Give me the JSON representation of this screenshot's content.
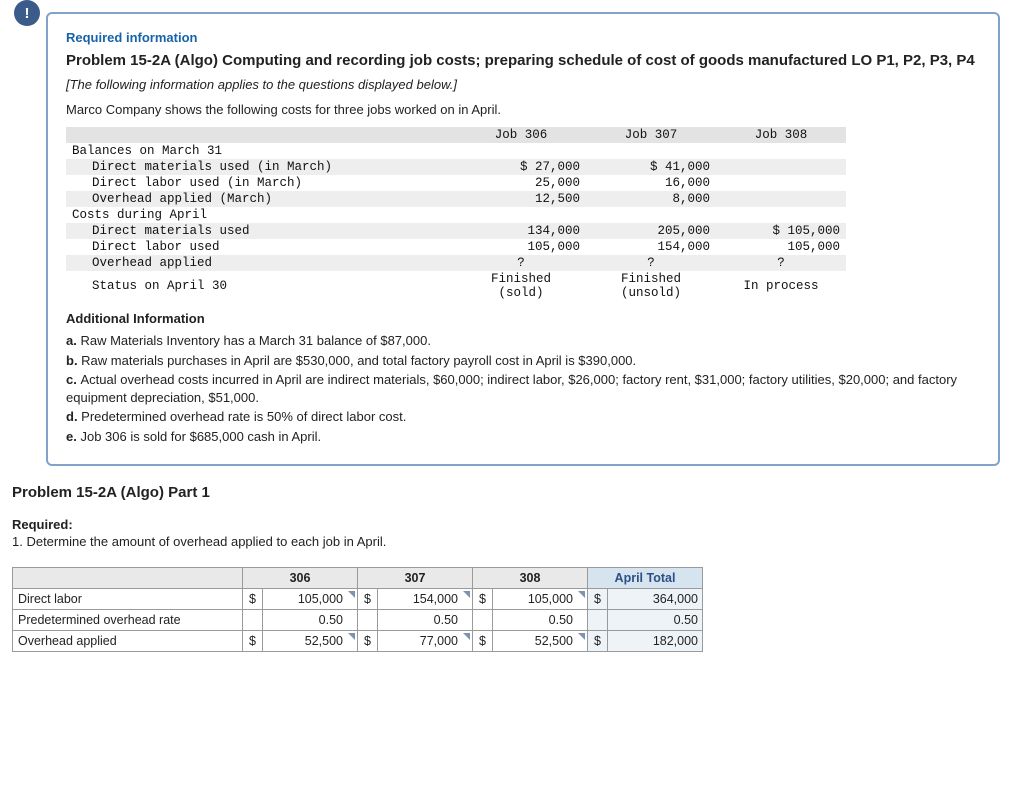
{
  "block": {
    "bang": "!",
    "req_title": "Required information",
    "prob_title": "Problem 15-2A (Algo) Computing and recording job costs; preparing schedule of cost of goods manufactured LO P1, P2, P3, P4",
    "italic_note": "[The following information applies to the questions displayed below.]",
    "intro": "Marco Company shows the following costs for three jobs worked on in April."
  },
  "jobs_table": {
    "headers": [
      "",
      "Job 306",
      "Job 307",
      "Job 308"
    ],
    "rows": [
      {
        "label": "Balances on March 31",
        "vals": [
          "",
          "",
          ""
        ],
        "section": true
      },
      {
        "label": "Direct materials used (in March)",
        "vals": [
          "$ 27,000",
          "$ 41,000",
          ""
        ],
        "indent": true
      },
      {
        "label": "Direct labor used (in March)",
        "vals": [
          "25,000",
          "16,000",
          ""
        ],
        "indent": true
      },
      {
        "label": "Overhead applied (March)",
        "vals": [
          "12,500",
          "8,000",
          ""
        ],
        "indent": true
      },
      {
        "label": "Costs during April",
        "vals": [
          "",
          "",
          ""
        ],
        "section": true
      },
      {
        "label": "Direct materials used",
        "vals": [
          "134,000",
          "205,000",
          "$ 105,000"
        ],
        "indent": true
      },
      {
        "label": "Direct labor used",
        "vals": [
          "105,000",
          "154,000",
          "105,000"
        ],
        "indent": true
      },
      {
        "label": "Overhead applied",
        "vals": [
          "?",
          "?",
          "?"
        ],
        "indent": true,
        "center": true
      },
      {
        "label": "Status on April 30",
        "vals": [
          "Finished\n(sold)",
          "Finished\n(unsold)",
          "In process"
        ],
        "indent": true,
        "center": true
      }
    ]
  },
  "additional": {
    "heading": "Additional Information",
    "items": [
      {
        "lab": "a.",
        "txt": "Raw Materials Inventory has a March 31 balance of $87,000."
      },
      {
        "lab": "b.",
        "txt": "Raw materials purchases in April are $530,000, and total factory payroll cost in April is $390,000."
      },
      {
        "lab": "c.",
        "txt": "Actual overhead costs incurred in April are indirect materials, $60,000; indirect labor, $26,000; factory rent, $31,000; factory utilities, $20,000; and factory equipment depreciation, $51,000."
      },
      {
        "lab": "d.",
        "txt": "Predetermined overhead rate is 50% of direct labor cost."
      },
      {
        "lab": "e.",
        "txt": "Job 306 is sold for $685,000 cash in April."
      }
    ]
  },
  "part": {
    "title": "Problem 15-2A (Algo) Part 1",
    "req_head": "Required:",
    "req_line": "1. Determine the amount of overhead applied to each job in April."
  },
  "answer": {
    "headers": [
      "",
      "306",
      "307",
      "308",
      "April Total"
    ],
    "rows": [
      {
        "label": "Direct labor",
        "sym": "$",
        "c306": "105,000",
        "c307": "154,000",
        "c308": "105,000",
        "tot": "364,000",
        "tri": true
      },
      {
        "label": "Predetermined overhead rate",
        "sym": "",
        "c306": "0.50",
        "c307": "0.50",
        "c308": "0.50",
        "tot": "0.50",
        "tri": false
      },
      {
        "label": "Overhead applied",
        "sym": "$",
        "c306": "52,500",
        "c307": "77,000",
        "c308": "52,500",
        "tot": "182,000",
        "tri": true
      }
    ]
  },
  "chart_data": {
    "type": "table",
    "title": "Overhead applied to each job in April",
    "columns": [
      "Job 306",
      "Job 307",
      "Job 308",
      "April Total"
    ],
    "rows": [
      {
        "label": "Direct labor ($)",
        "values": [
          105000,
          154000,
          105000,
          364000
        ]
      },
      {
        "label": "Predetermined overhead rate",
        "values": [
          0.5,
          0.5,
          0.5,
          0.5
        ]
      },
      {
        "label": "Overhead applied ($)",
        "values": [
          52500,
          77000,
          52500,
          182000
        ]
      }
    ]
  }
}
